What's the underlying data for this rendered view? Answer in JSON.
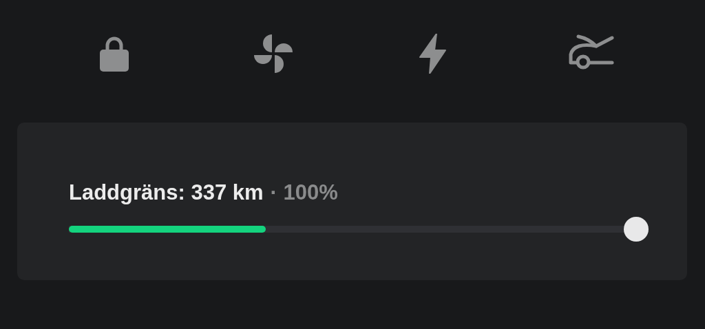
{
  "charge_limit": {
    "range": "Laddgräns: 337 km",
    "percent": "· 100%"
  },
  "slider": {
    "charge": {
      "level": 0.34
    },
    "limit": {
      "level": 1.0
    }
  }
}
